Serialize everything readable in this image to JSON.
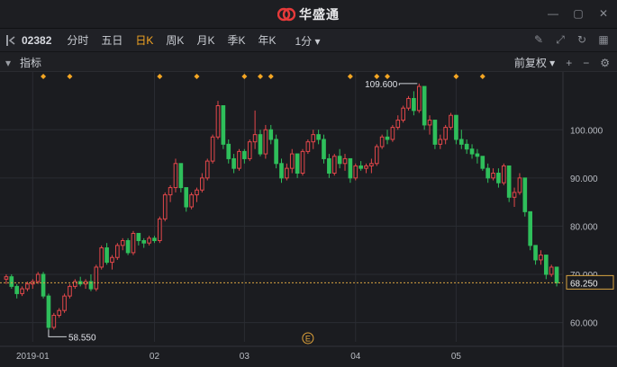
{
  "app": {
    "title": "华盛通"
  },
  "toolbar": {
    "stock_code": "02382",
    "periods": [
      "分时",
      "五日",
      "日K",
      "周K",
      "月K",
      "季K",
      "年K"
    ],
    "active_period": "日K",
    "minute_select": "1分 ▾"
  },
  "indicator_bar": {
    "label": "指标",
    "adjust_label": "前复权 ▾"
  },
  "chart_data": {
    "type": "candlestick",
    "ylim": [
      56,
      112
    ],
    "y_ticks": [
      "100.000",
      "90.000",
      "80.000",
      "70.000",
      "60.000"
    ],
    "y_tick_values": [
      100,
      90,
      80,
      70,
      60
    ],
    "x_labels": [
      {
        "text": "2019-01",
        "index": 5
      },
      {
        "text": "02",
        "index": 28
      },
      {
        "text": "03",
        "index": 45
      },
      {
        "text": "04",
        "index": 66
      },
      {
        "text": "05",
        "index": 85
      }
    ],
    "current_price": "68.250",
    "current_price_value": 68.25,
    "high_label": "109.600",
    "high_value": 109.6,
    "low_label": "58.550",
    "low_value": 58.55,
    "event_marker": "E",
    "event_index": 57,
    "dividend_marker_indices": [
      7,
      12,
      29,
      36,
      45,
      48,
      50,
      65,
      70,
      72,
      85,
      90
    ],
    "candles": [
      [
        69,
        70,
        68,
        69.5
      ],
      [
        69.5,
        70,
        67,
        67.5
      ],
      [
        67.5,
        68,
        65,
        66
      ],
      [
        66,
        67.5,
        65.5,
        67
      ],
      [
        67,
        68.5,
        66.5,
        68
      ],
      [
        68,
        69,
        67,
        68.5
      ],
      [
        68.5,
        70.5,
        68,
        70
      ],
      [
        70,
        70.5,
        65,
        65.5
      ],
      [
        65.5,
        66,
        58.5,
        59
      ],
      [
        59,
        62,
        58.55,
        61.5
      ],
      [
        61.5,
        63,
        61,
        62.5
      ],
      [
        62.5,
        66,
        62,
        65.5
      ],
      [
        65.5,
        68,
        65,
        67.5
      ],
      [
        67.5,
        69,
        67,
        68.5
      ],
      [
        68.5,
        69.5,
        67.5,
        68
      ],
      [
        68,
        69,
        67,
        68.5
      ],
      [
        68.5,
        70,
        66.5,
        67
      ],
      [
        67,
        72,
        66.5,
        71.5
      ],
      [
        71.5,
        76,
        71,
        75.5
      ],
      [
        75.5,
        76.5,
        72,
        72.5
      ],
      [
        72.5,
        74,
        71,
        73.5
      ],
      [
        73.5,
        76.5,
        73,
        76
      ],
      [
        76,
        77.5,
        75,
        77
      ],
      [
        77,
        77.5,
        74,
        74.5
      ],
      [
        74.5,
        79,
        74,
        78.5
      ],
      [
        78.5,
        78.5,
        76,
        77
      ],
      [
        77,
        77.5,
        75.5,
        76.5
      ],
      [
        76.5,
        78,
        76,
        77.5
      ],
      [
        77.5,
        78,
        76.5,
        77
      ],
      [
        77,
        82,
        76.5,
        81.5
      ],
      [
        81.5,
        87,
        81,
        86.5
      ],
      [
        86.5,
        88.5,
        85,
        88
      ],
      [
        88,
        94,
        87,
        93
      ],
      [
        93,
        91,
        87,
        88
      ],
      [
        88,
        86,
        83,
        84
      ],
      [
        84,
        87,
        83.5,
        86.5
      ],
      [
        86.5,
        88,
        85,
        87.5
      ],
      [
        87.5,
        91,
        87,
        90
      ],
      [
        90,
        94,
        89.5,
        93.5
      ],
      [
        93.5,
        99,
        93,
        98.5
      ],
      [
        98.5,
        106,
        98,
        105
      ],
      [
        105,
        100,
        96,
        97
      ],
      [
        97,
        98,
        93,
        94
      ],
      [
        94,
        95,
        91,
        92
      ],
      [
        92,
        96,
        91.5,
        95.5
      ],
      [
        95.5,
        96,
        93,
        94
      ],
      [
        94,
        98,
        93.5,
        97.5
      ],
      [
        97.5,
        104,
        96,
        99
      ],
      [
        99,
        100,
        94.5,
        95
      ],
      [
        95,
        101,
        94,
        100
      ],
      [
        100,
        101,
        97,
        98
      ],
      [
        98,
        99,
        92,
        93
      ],
      [
        93,
        94,
        89,
        90
      ],
      [
        90,
        93,
        89.5,
        92
      ],
      [
        92,
        96,
        91,
        95
      ],
      [
        95,
        94,
        90,
        91
      ],
      [
        91,
        96,
        90.5,
        95.5
      ],
      [
        95.5,
        98,
        95,
        97.5
      ],
      [
        97.5,
        100,
        96,
        99
      ],
      [
        99,
        100,
        97,
        98
      ],
      [
        98,
        99,
        93,
        94
      ],
      [
        94,
        95,
        90,
        91
      ],
      [
        91,
        95,
        90.5,
        94.5
      ],
      [
        94.5,
        96,
        92,
        93
      ],
      [
        93,
        95,
        91.5,
        94
      ],
      [
        94,
        92,
        89,
        90
      ],
      [
        90,
        93,
        89.5,
        92.5
      ],
      [
        92.5,
        93.5,
        91.5,
        92
      ],
      [
        92,
        93,
        91,
        92.5
      ],
      [
        92.5,
        94,
        91,
        93
      ],
      [
        93,
        97,
        92.5,
        96.5
      ],
      [
        96.5,
        99,
        96,
        98.5
      ],
      [
        98.5,
        100,
        97,
        98
      ],
      [
        98,
        101,
        97.5,
        100.5
      ],
      [
        100.5,
        103,
        100,
        102
      ],
      [
        102,
        105,
        101.5,
        104.5
      ],
      [
        104.5,
        107,
        104,
        106.5
      ],
      [
        106.5,
        108,
        103,
        104
      ],
      [
        104,
        109.6,
        103.5,
        109
      ],
      [
        109,
        106,
        100,
        101
      ],
      [
        101,
        103,
        99,
        102
      ],
      [
        102,
        100,
        96,
        97
      ],
      [
        97,
        99,
        96,
        98
      ],
      [
        98,
        101,
        97,
        100.5
      ],
      [
        100.5,
        103.5,
        100,
        103
      ],
      [
        103,
        101,
        97,
        98
      ],
      [
        98,
        100,
        96,
        97
      ],
      [
        97,
        98,
        95,
        96
      ],
      [
        96,
        97,
        94,
        95
      ],
      [
        95,
        96,
        93,
        94.5
      ],
      [
        94.5,
        93,
        91.5,
        92
      ],
      [
        92,
        93,
        89,
        90
      ],
      [
        90,
        92,
        89.5,
        91
      ],
      [
        91,
        92,
        88,
        89
      ],
      [
        89,
        93,
        88.5,
        92.5
      ],
      [
        92.5,
        90,
        85,
        86
      ],
      [
        86,
        88,
        84,
        87
      ],
      [
        87,
        91,
        86.5,
        90
      ],
      [
        90,
        87,
        82,
        83
      ],
      [
        83,
        76,
        75,
        76
      ],
      [
        76,
        74,
        72,
        73
      ],
      [
        73,
        75,
        72,
        74
      ],
      [
        74,
        72,
        69,
        70
      ],
      [
        70,
        72,
        69.5,
        71.5
      ],
      [
        71.5,
        69,
        67.5,
        68.25
      ]
    ]
  }
}
